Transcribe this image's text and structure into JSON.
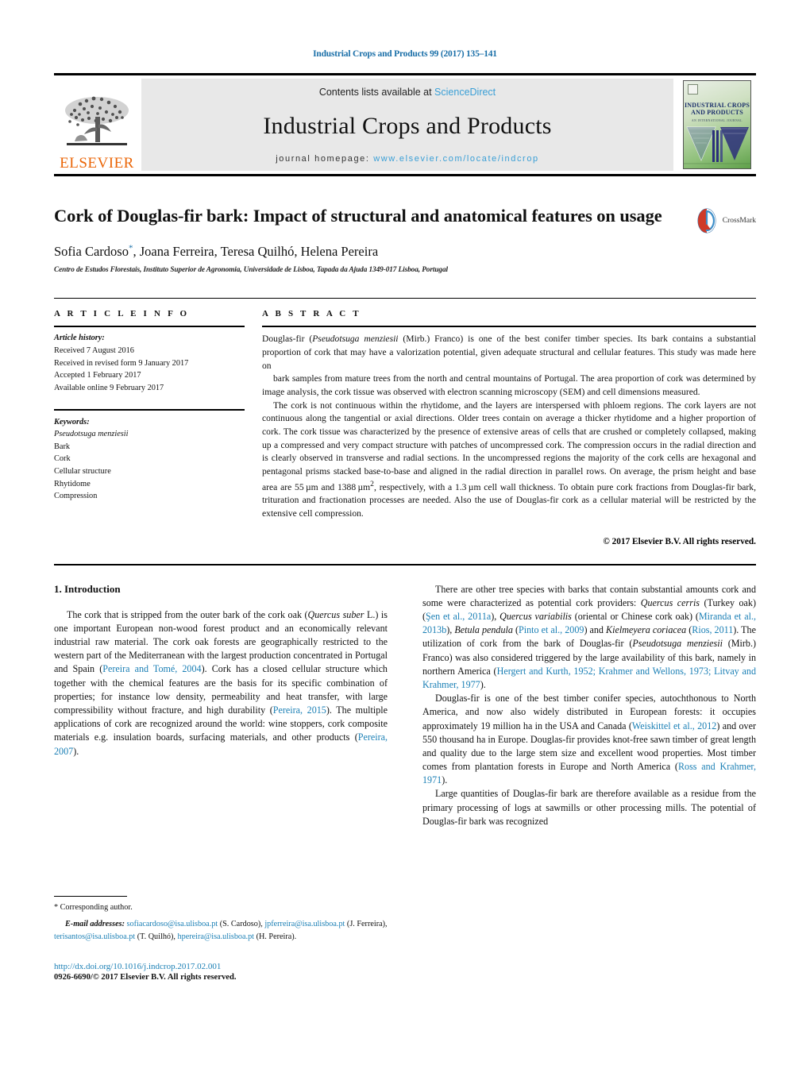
{
  "running_head": "Industrial Crops and Products 99 (2017) 135–141",
  "masthead": {
    "publisher_logo_text": "ELSEVIER",
    "contents_prefix": "Contents lists available at ",
    "contents_link": "ScienceDirect",
    "journal_name": "Industrial Crops and Products",
    "homepage_prefix": "journal homepage: ",
    "homepage_url": "www.elsevier.com/locate/indcrop",
    "cover_title": "INDUSTRIAL CROPS AND PRODUCTS",
    "cover_subtitle": "AN INTERNATIONAL JOURNAL"
  },
  "article": {
    "title": "Cork of Douglas-fir bark: Impact of structural and anatomical features on usage",
    "authors": "Sofia Cardoso, Joana Ferreira, Teresa Quilhó, Helena Pereira",
    "corresponding_marker": "*",
    "affiliation": "Centro de Estudos Florestais, Instituto Superior de Agronomia, Universidade de Lisboa, Tapada da Ajuda 1349-017 Lisboa, Portugal",
    "crossmark_label": "CrossMark"
  },
  "article_info": {
    "heading": "A R T I C L E   I N F O",
    "history_label": "Article history:",
    "history": [
      "Received 7 August 2016",
      "Received in revised form 9 January 2017",
      "Accepted 1 February 2017",
      "Available online 9 February 2017"
    ],
    "keywords_label": "Keywords:",
    "keywords": [
      "Pseudotsuga menziesii",
      "Bark",
      "Cork",
      "Cellular structure",
      "Rhytidome",
      "Compression"
    ]
  },
  "abstract": {
    "heading": "A B S T R A C T",
    "paragraphs": [
      "Douglas-fir (<i>Pseudotsuga menziesii</i> (Mirb.) Franco) is one of the best conifer timber species. Its bark contains a substantial proportion of cork that may have a valorization potential, given adequate structural and cellular features. This study was made here on",
      "bark samples from mature trees from the north and central mountains of Portugal. The area proportion of cork was determined by image analysis, the cork tissue was observed with electron scanning microscopy (SEM) and cell dimensions measured.",
      "The cork is not continuous within the rhytidome, and the layers are interspersed with phloem regions. The cork layers are not continuous along the tangential or axial directions. Older trees contain on average a thicker rhytidome and a higher proportion of cork. The cork tissue was characterized by the presence of extensive areas of cells that are crushed or completely collapsed, making up a compressed and very compact structure with patches of uncompressed cork. The compression occurs in the radial direction and is clearly observed in transverse and radial sections. In the uncompressed regions the majority of the cork cells are hexagonal and pentagonal prisms stacked base-to-base and aligned in the radial direction in parallel rows. On average, the prism height and base area are 55&thinsp;&micro;m and 1388&thinsp;&micro;m<sup>2</sup>, respectively, with a 1.3&thinsp;&micro;m cell wall thickness. To obtain pure cork fractions from Douglas-fir bark, trituration and fractionation processes are needed. Also the use of Douglas-fir cork as a cellular material will be restricted by the extensive cell compression."
    ],
    "copyright": "© 2017 Elsevier B.V. All rights reserved."
  },
  "introduction": {
    "heading": "1.  Introduction",
    "left_paragraphs": [
      "The cork that is stripped from the outer bark of the cork oak (<i>Quercus suber</i> L.) is one important European non-wood forest product and an economically relevant industrial raw material. The cork oak forests are geographically restricted to the western part of the Mediterranean with the largest production concentrated in Portugal and Spain (<span class=\"ref\">Pereira and Tomé, 2004</span>). Cork has a closed cellular structure which together with the chemical features are the basis for its specific combination of properties; for instance low density, permeability and heat transfer, with large compressibility without fracture, and high durability (<span class=\"ref\">Pereira, 2015</span>). The multiple applications of cork are recognized around the world: wine stoppers, cork composite materials e.g. insulation boards, surfacing materials, and other products (<span class=\"ref\">Pereira, 2007</span>)."
    ],
    "right_paragraphs": [
      "There are other tree species with barks that contain substantial amounts cork and some were characterized as potential cork providers: <i>Quercus cerris</i> (Turkey oak) (<span class=\"ref\">Şen et al., 2011a</span>), <i>Quercus variabilis</i> (oriental or Chinese cork oak) (<span class=\"ref\">Miranda et al., 2013b</span>), <i>Betula pendula</i> (<span class=\"ref\">Pinto et al., 2009</span>) and <i>Kielmeyera coriacea</i> (<span class=\"ref\">Rios, 2011</span>). The utilization of cork from the bark of Douglas-fir (<i>Pseudotsuga menziesii</i> (Mirb.) Franco) was also considered triggered by the large availability of this bark, namely in northern America (<span class=\"ref\">Hergert and Kurth, 1952; Krahmer and Wellons, 1973; Litvay and Krahmer, 1977</span>).",
      "Douglas-fir is one of the best timber conifer species, autochthonous to North America, and now also widely distributed in European forests: it occupies approximately 19 million ha in the USA and Canada (<span class=\"ref\">Weiskittel et al., 2012</span>) and over 550 thousand ha in Europe. Douglas-fir provides knot-free sawn timber of great length and quality due to the large stem size and excellent wood properties. Most timber comes from plantation forests in Europe and North America (<span class=\"ref\">Ross and Krahmer, 1971</span>).",
      "Large quantities of Douglas-fir bark are therefore available as a residue from the primary processing of logs at sawmills or other processing mills. The potential of Douglas-fir bark was recognized"
    ]
  },
  "footnotes": {
    "corresponding": "*  Corresponding author.",
    "email_label": "E-mail addresses:",
    "emails": "<span class=\"ref\">sofiacardoso@isa.ulisboa.pt</span> (S. Cardoso), <span class=\"ref\">jpferreira@isa.ulisboa.pt</span> (J. Ferreira), <span class=\"ref\">terisantos@isa.ulisboa.pt</span> (T. Quilhó), <span class=\"ref\">hpereira@isa.ulisboa.pt</span> (H. Pereira).",
    "doi": "http://dx.doi.org/10.1016/j.indcrop.2017.02.001",
    "issn": "0926-6690/© 2017 Elsevier B.V. All rights reserved."
  },
  "colors": {
    "link_blue": "#1a7fb5",
    "elsevier_orange": "#eb6608",
    "sciencedirect_blue": "#3a9fd6",
    "band_gray": "#e8e8e8"
  }
}
